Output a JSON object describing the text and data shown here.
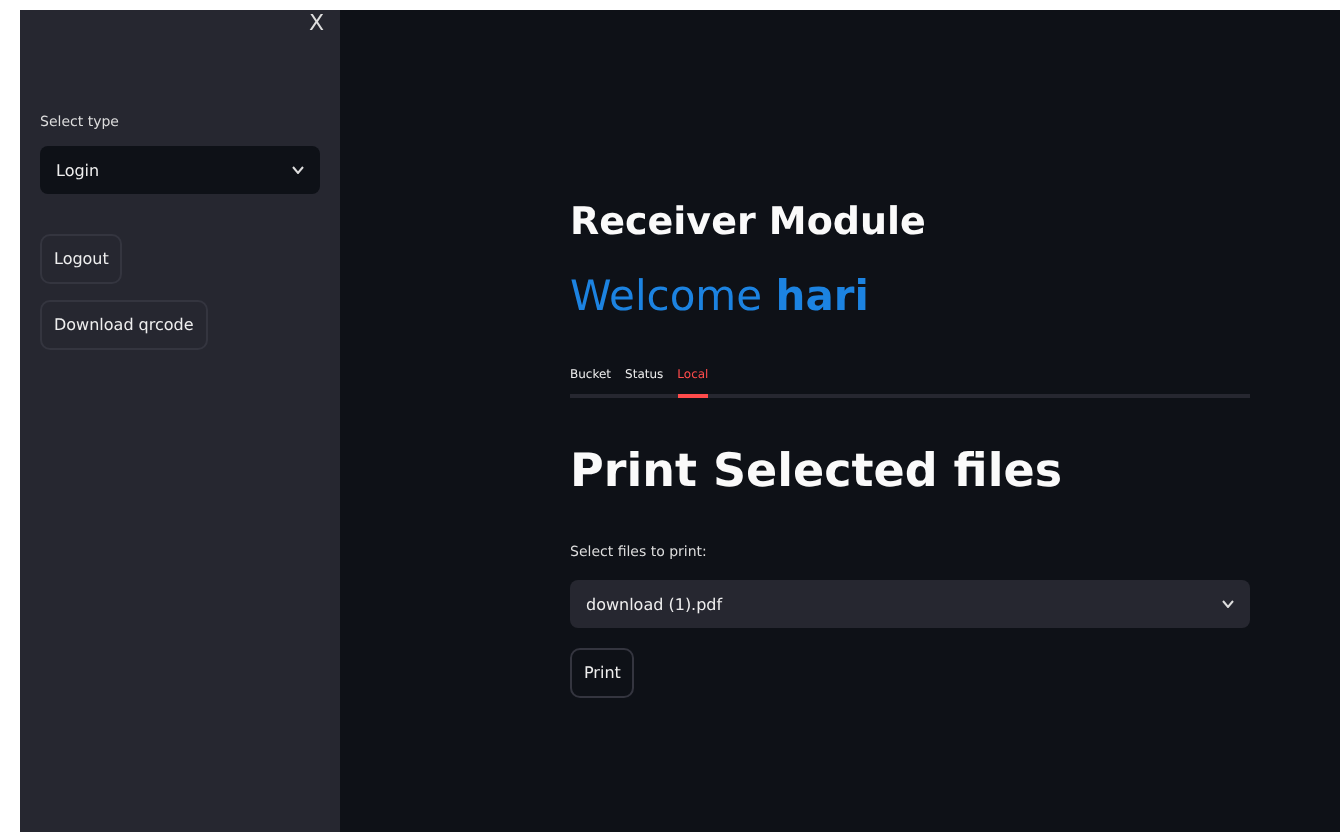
{
  "sidebar": {
    "close": "X",
    "select": {
      "label": "Select type",
      "value": "Login"
    },
    "buttons": [
      "Logout",
      "Download qrcode"
    ]
  },
  "main": {
    "title": "Receiver Module",
    "welcome": {
      "prefix": "Welcome",
      "name": "hari"
    },
    "tabs": [
      {
        "label": "Bucket",
        "selected": false
      },
      {
        "label": "Status",
        "selected": false
      },
      {
        "label": "Local",
        "selected": true
      }
    ],
    "section_title": "Print Selected files",
    "file_select": {
      "label": "Select files to print:",
      "value": "download (1).pdf"
    },
    "print_button": "Print"
  }
}
